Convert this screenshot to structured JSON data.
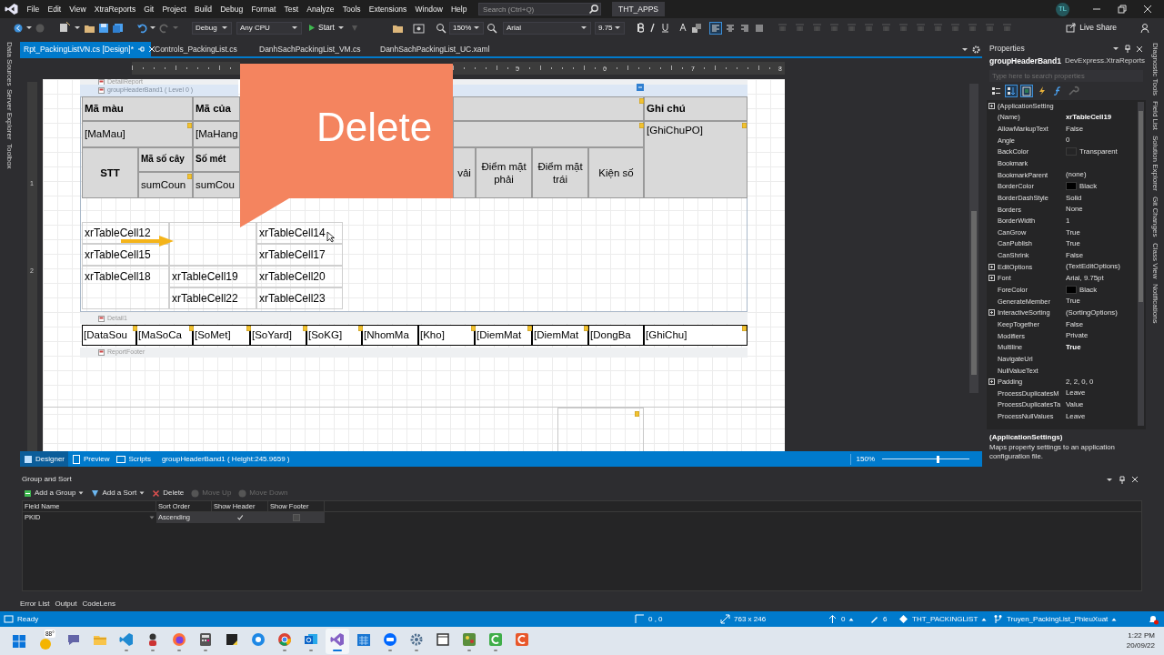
{
  "menu_bar": {
    "items": [
      "File",
      "Edit",
      "View",
      "XtraReports",
      "Git",
      "Project",
      "Build",
      "Debug",
      "Format",
      "Test",
      "Analyze",
      "Tools",
      "Extensions",
      "Window",
      "Help"
    ],
    "search": {
      "placeholder": "Search (Ctrl+Q)"
    },
    "solution_name": "THT_APPS",
    "account_initials": "TL"
  },
  "toolbar": {
    "configuration": "Debug",
    "platform": "Any CPU",
    "start": "Start",
    "zoom": "150%",
    "font": "Arial",
    "font_size": "9.75",
    "live_share": "Live Share"
  },
  "left_tool_windows": [
    "Data Sources",
    "Server Explorer",
    "Toolbox"
  ],
  "right_tool_windows": [
    "Diagnostic Tools",
    "Field List",
    "Solution Explorer",
    "Git Changes",
    "Class View",
    "Notifications"
  ],
  "document_tabs": [
    {
      "label": "Rpt_PackingListVN.cs [Design]*",
      "selected": true
    },
    {
      "label": "Controls_PackingList.cs",
      "selected": false
    },
    {
      "label": "DanhSachPackingList_VM.cs",
      "selected": false
    },
    {
      "label": "DanhSachPackingList_UC.xaml",
      "selected": false
    }
  ],
  "designer": {
    "ruler_numbers": [
      "5",
      "6",
      "7",
      "8"
    ],
    "side_ruler_numbers": [
      "1",
      "2"
    ],
    "bands": [
      {
        "label": "DetailReport",
        "selected": false
      },
      {
        "label": "groupHeaderBand1 ( Level 0 )",
        "selected": true
      },
      {
        "label": "Detail1",
        "selected": false
      },
      {
        "label": "ReportFooter",
        "selected": false
      }
    ],
    "header_table": [
      {
        "text": "Mã màu",
        "bold": true
      },
      {
        "text": "Mã của",
        "bold": true
      },
      {
        "text": "Ghi chú",
        "bold": true
      },
      {
        "text": "[MaMau]",
        "bold": false
      },
      {
        "text": "[MaHang",
        "bold": false
      },
      {
        "text": "[GhiChuPO]",
        "bold": false
      },
      {
        "text": "STT",
        "bold": true
      },
      {
        "text": "Mã số cây",
        "bold": true
      },
      {
        "text": "sumCoun",
        "bold": false
      },
      {
        "text": "Số mét",
        "bold": true
      },
      {
        "text": "sumCou",
        "bold": false
      },
      {
        "text": "vải",
        "bold": false
      },
      {
        "text": "Điểm mặt phải",
        "bold": false
      },
      {
        "text": "Điểm mặt trái",
        "bold": false
      },
      {
        "text": "Kiện số",
        "bold": false
      }
    ],
    "body_table": [
      "xrTableCell12",
      "xrTableCell14",
      "xrTableCell15",
      "xrTableCell17",
      "xrTableCell18",
      "xrTableCell19",
      "xrTableCell20",
      "xrTableCell22",
      "xrTableCell23"
    ],
    "detail_row": [
      "[DataSou",
      "[MaSoCa",
      "[SoMet]",
      "[SoYard]",
      "[SoKG]",
      "[NhomMa",
      "[Kho]",
      "[DiemMat",
      "[DiemMat",
      "[DongBa",
      "[GhiChu]"
    ],
    "callout": "Delete"
  },
  "designer_tabs": [
    {
      "label": "Designer",
      "selected": true
    },
    {
      "label": "Preview",
      "selected": false
    },
    {
      "label": "Scripts",
      "selected": false
    }
  ],
  "designer_status": "groupHeaderBand1 ( Height:245.9659 )",
  "zoom": {
    "text": "150%",
    "level": 0.65
  },
  "properties": {
    "title": "Properties",
    "object_name": "groupHeaderBand1",
    "object_type": "DevExpress.XtraReports",
    "search": {
      "placeholder": "Type here to search properties"
    },
    "toolbar": [
      {
        "kind": "categorized",
        "selected": false
      },
      {
        "kind": "alphabetical",
        "selected": true
      },
      {
        "kind": "properties",
        "selected": true
      },
      {
        "kind": "events",
        "selected": false
      },
      {
        "kind": "expressions",
        "selected": false
      },
      {
        "kind": "wrench",
        "selected": false
      }
    ],
    "rows": [
      {
        "name": "(ApplicationSetting",
        "kind": "group"
      },
      {
        "name": "(Name)",
        "value": "xrTableCell19",
        "kind": "plain",
        "bold": true
      },
      {
        "name": "AllowMarkupText",
        "value": "False",
        "kind": "plain",
        "bold": false
      },
      {
        "name": "Angle",
        "value": "0",
        "kind": "plain",
        "bold": false
      },
      {
        "name": "BackColor",
        "value": "Transparent",
        "kind": "color",
        "bold": false
      },
      {
        "name": "Bookmark",
        "kind": "plain"
      },
      {
        "name": "BookmarkParent",
        "value": "(none)",
        "kind": "plain",
        "bold": false
      },
      {
        "name": "BorderColor",
        "value": "Black",
        "kind": "color",
        "color": "#000000",
        "bold": false
      },
      {
        "name": "BorderDashStyle",
        "value": "Solid",
        "kind": "plain",
        "bold": false
      },
      {
        "name": "Borders",
        "value": "None",
        "kind": "plain",
        "bold": false
      },
      {
        "name": "BorderWidth",
        "value": "1",
        "kind": "plain",
        "bold": false
      },
      {
        "name": "CanGrow",
        "value": "True",
        "kind": "plain",
        "bold": false
      },
      {
        "name": "CanPublish",
        "value": "True",
        "kind": "plain",
        "bold": false
      },
      {
        "name": "CanShrink",
        "value": "False",
        "kind": "plain",
        "bold": false
      },
      {
        "name": "EditOptions",
        "value": "(TextEditOptions)",
        "kind": "group",
        "bold": false
      },
      {
        "name": "Font",
        "value": "Arial, 9.75pt",
        "kind": "group",
        "bold": false
      },
      {
        "name": "ForeColor",
        "value": "Black",
        "kind": "color",
        "color": "#000000",
        "bold": false
      },
      {
        "name": "GenerateMember",
        "value": "True",
        "kind": "plain",
        "bold": false
      },
      {
        "name": "InteractiveSorting",
        "value": "(SortingOptions)",
        "kind": "group",
        "bold": false
      },
      {
        "name": "KeepTogether",
        "value": "False",
        "kind": "plain",
        "bold": false
      },
      {
        "name": "Modifiers",
        "value": "Private",
        "kind": "plain",
        "bold": false
      },
      {
        "name": "Multiline",
        "value": "True",
        "kind": "plain",
        "bold": true
      },
      {
        "name": "NavigateUrl",
        "kind": "plain"
      },
      {
        "name": "NullValueText",
        "kind": "plain"
      },
      {
        "name": "Padding",
        "value": "2, 2, 0, 0",
        "kind": "group",
        "bold": false
      },
      {
        "name": "ProcessDuplicatesM",
        "value": "Leave",
        "kind": "plain",
        "bold": false
      },
      {
        "name": "ProcessDuplicatesTa",
        "value": "Value",
        "kind": "plain",
        "bold": false
      },
      {
        "name": "ProcessNullValues",
        "value": "Leave",
        "kind": "plain",
        "bold": false
      }
    ],
    "description": {
      "title": "(ApplicationSettings)",
      "text": "Maps property settings to an application configuration file."
    }
  },
  "group_and_sort": {
    "title": "Group and Sort",
    "actions": [
      {
        "label": "Add a Group",
        "kind": "add_group",
        "disabled": false
      },
      {
        "label": "Add a Sort",
        "kind": "add_sort",
        "disabled": false
      },
      {
        "label": "Delete",
        "kind": "delete",
        "disabled": false
      },
      {
        "label": "Move Up",
        "kind": "move_up",
        "disabled": true
      },
      {
        "label": "Move Down",
        "kind": "move_down",
        "disabled": true
      }
    ],
    "columns": [
      "Field Name",
      "Sort Order",
      "Show Header",
      "Show Footer"
    ],
    "rows": [
      {
        "field": "PKID",
        "sort_order": "Ascending",
        "show_header": true,
        "show_footer": false
      }
    ]
  },
  "bottom_tabs": [
    "Error List",
    "Output",
    "CodeLens"
  ],
  "status_bar": [
    {
      "kind": "ready",
      "text": "Ready"
    },
    {
      "kind": "position",
      "text": "0 , 0"
    },
    {
      "kind": "size",
      "text": "763 x 246"
    },
    {
      "kind": "push",
      "text": "0"
    },
    {
      "kind": "edits",
      "text": "6"
    },
    {
      "kind": "repo",
      "text": "THT_PACKINGLIST"
    },
    {
      "kind": "branch",
      "text": "Truyen_PackingList_PhieuXuat"
    }
  ],
  "taskbar": {
    "weather": "88°",
    "time": "1:22 PM",
    "date": "20/09/22",
    "apps": [
      {
        "kind": "chat",
        "running": false,
        "selected": false
      },
      {
        "kind": "folder",
        "running": false,
        "selected": false
      },
      {
        "kind": "vscode",
        "running": true,
        "selected": false
      },
      {
        "kind": "sandbox",
        "running": true,
        "selected": false
      },
      {
        "kind": "firefox",
        "running": true,
        "selected": false
      },
      {
        "kind": "calculator",
        "running": true,
        "selected": false
      },
      {
        "kind": "sticky",
        "running": false,
        "selected": false
      },
      {
        "kind": "browser",
        "running": false,
        "selected": false
      },
      {
        "kind": "chrome",
        "running": true,
        "selected": false
      },
      {
        "kind": "outlook",
        "running": true,
        "selected": false
      },
      {
        "kind": "visualstudio",
        "running": true,
        "selected": true
      },
      {
        "kind": "calendar",
        "running": false,
        "selected": false
      },
      {
        "kind": "zalo",
        "running": true,
        "selected": false
      },
      {
        "kind": "settings",
        "running": true,
        "selected": false
      },
      {
        "kind": "window",
        "running": false,
        "selected": false
      },
      {
        "kind": "paint",
        "running": true,
        "selected": false
      },
      {
        "kind": "recorder",
        "running": true,
        "selected": false
      },
      {
        "kind": "editor",
        "running": false,
        "selected": false
      }
    ]
  }
}
